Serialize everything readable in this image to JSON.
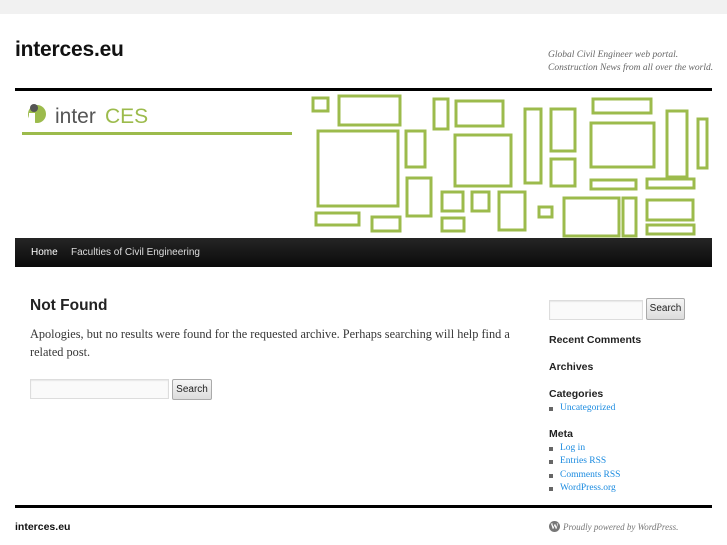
{
  "site": {
    "title": "interces.eu",
    "description": "Global Civil Engineer web portal. Construction News from all over the world."
  },
  "banner": {
    "logo_text_dark": "inter",
    "logo_text_accent": "CES",
    "accent_color": "#9cbb4c",
    "logo_dark_color": "#555555"
  },
  "nav": {
    "items": [
      {
        "label": "Home"
      },
      {
        "label": "Faculties of Civil Engineering"
      }
    ]
  },
  "main": {
    "title": "Not Found",
    "message": "Apologies, but no results were found for the requested archive. Perhaps searching will help find a related post.",
    "search_button": "Search",
    "search_value": ""
  },
  "sidebar": {
    "search_button": "Search",
    "search_value": "",
    "recent_comments_title": "Recent Comments",
    "archives_title": "Archives",
    "categories_title": "Categories",
    "categories": [
      "Uncategorized"
    ],
    "meta_title": "Meta",
    "meta_links": [
      "Log in",
      "Entries RSS",
      "Comments RSS",
      "WordPress.org"
    ]
  },
  "footer": {
    "site": "interces.eu",
    "credit": "Proudly powered by WordPress."
  },
  "colors": {
    "link": "#1b8be0",
    "nav_bg": "#111111"
  }
}
